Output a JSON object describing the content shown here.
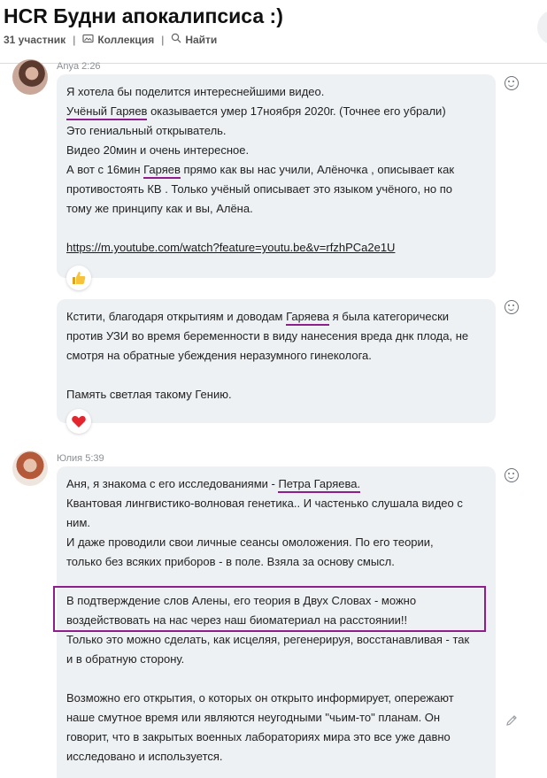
{
  "header": {
    "title": "HCR Будни апокалипсиса :)",
    "participants": "31 участник",
    "collection_label": "Коллекция",
    "find_label": "Найти"
  },
  "messages": [
    {
      "author": "Anya",
      "time": "2:26",
      "bubbles": [
        {
          "lines": [
            "Я хотела бы поделится интереснейшими видео.",
            "Учёный Гаряев|оказывается умер 17ноября 2020г. (Точнее его убрали)",
            "Это гениальный открыватель.",
            "Видео 20мин и очень интересное.",
            "А вот с 16мин |Гаряев| прямо как вы нас учили, Алёночка , описывает как",
            "противостоять КВ . Только учёный описывает это языком учёного, но по",
            "тому же принципу как и вы, Алёна.",
            "",
            "https://m.youtube.com/watch?feature=youtu.be&v=rfzhPCa2e1U"
          ],
          "reaction": "thumbs-up"
        },
        {
          "lines": [
            "Кстити, благодаря открытиям и доводам Гаряева я была категорически",
            "против УЗИ во время беременности в виду нанесения вреда днк плода, не",
            "смотря на обратные убеждения неразумного гинеколога.",
            "",
            "Память светлая такому Гению."
          ],
          "reaction": "heart"
        }
      ]
    },
    {
      "author": "Юлия",
      "time": "5:39",
      "bubbles": [
        {
          "lines": [
            "Аня, я знакома с его исследованиями - Петра Гаряева.",
            "Квантовая лингвистико-волновая генетика.. И частенько слушала видео с",
            "ним.",
            "И даже проводили свои личные сеансы омоложения. По его теории,",
            "только без всяких приборов - в поле. Взяла за основу смысл.",
            "",
            "В подтверждение слов Алены, его теория в Двух Словах - можно",
            "воздействовать на нас через наш биоматериал на расстоянии!!",
            "Только это можно сделать, как исцеляя, регенерируя, восстанавливая - так",
            "и в обратную сторону.",
            "",
            "Возможно его открытия, о которых он открыто информирует, опережают",
            "наше смутное время или являются неугодными \"чьим-то\" планам. Он",
            "говорит, что в закрытых военных лабораториях мира это все уже давно",
            "исследовано и используется."
          ]
        }
      ]
    }
  ],
  "underlined": {
    "a": "Учёный Гаряев",
    "a_rest": " оказывается умер 17ноября 2020г. (Точнее его убрали)",
    "b_pre": "А вот с 16мин ",
    "b": "Гаряев",
    "b_rest": " прямо как вы нас учили, Алёночка , описывает как",
    "c_pre": "Кстити, благодаря открытиям и доводам ",
    "c": "Гаряева",
    "c_rest": " я была категорически",
    "d_pre": "Аня, я знакома с его исследованиями - ",
    "d": "Петра Гаряева."
  },
  "colors": {
    "accent_underline": "#8e1e8b",
    "bubble": "#eef1f4"
  }
}
